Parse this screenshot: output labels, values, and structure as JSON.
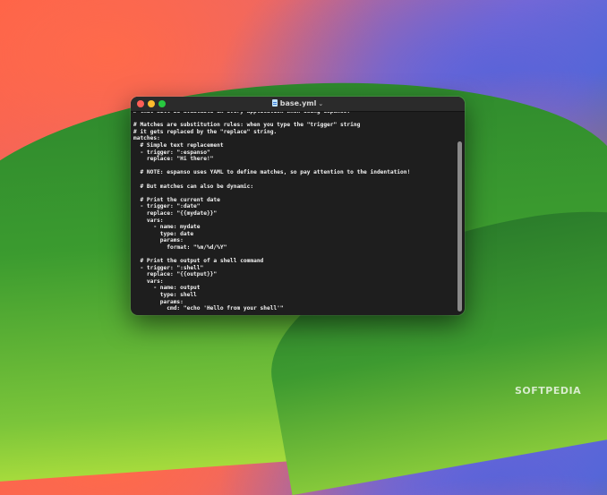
{
  "window": {
    "title": "base.yml",
    "title_icon": "document-icon",
    "chevron_icon": "chevron-down-icon"
  },
  "code_lines": [
    "# that will be available in every application when using espanso.",
    "",
    "# Matches are substitution rules: when you type the \"trigger\" string",
    "# it gets replaced by the \"replace\" string.",
    "matches:",
    "  # Simple text replacement",
    "  - trigger: \":espanso\"",
    "    replace: \"Hi there!\"",
    "",
    "  # NOTE: espanso uses YAML to define matches, so pay attention to the indentation!",
    "",
    "  # But matches can also be dynamic:",
    "",
    "  # Print the current date",
    "  - trigger: \":date\"",
    "    replace: \"{{mydate}}\"",
    "    vars:",
    "      - name: mydate",
    "        type: date",
    "        params:",
    "          format: \"%m/%d/%Y\"",
    "",
    "  # Print the output of a shell command",
    "  - trigger: \":shell\"",
    "    replace: \"{{output}}\"",
    "    vars:",
    "      - name: output",
    "        type: shell",
    "        params:",
    "          cmd: \"echo 'Hello from your shell'\""
  ],
  "watermark": "SOFTPEDIA",
  "colors": {
    "editor_bg": "#1e1e1e",
    "titlebar_bg": "#2b2b2b",
    "close": "#ff5f57",
    "minimize": "#febc2e",
    "zoom": "#28c840"
  }
}
